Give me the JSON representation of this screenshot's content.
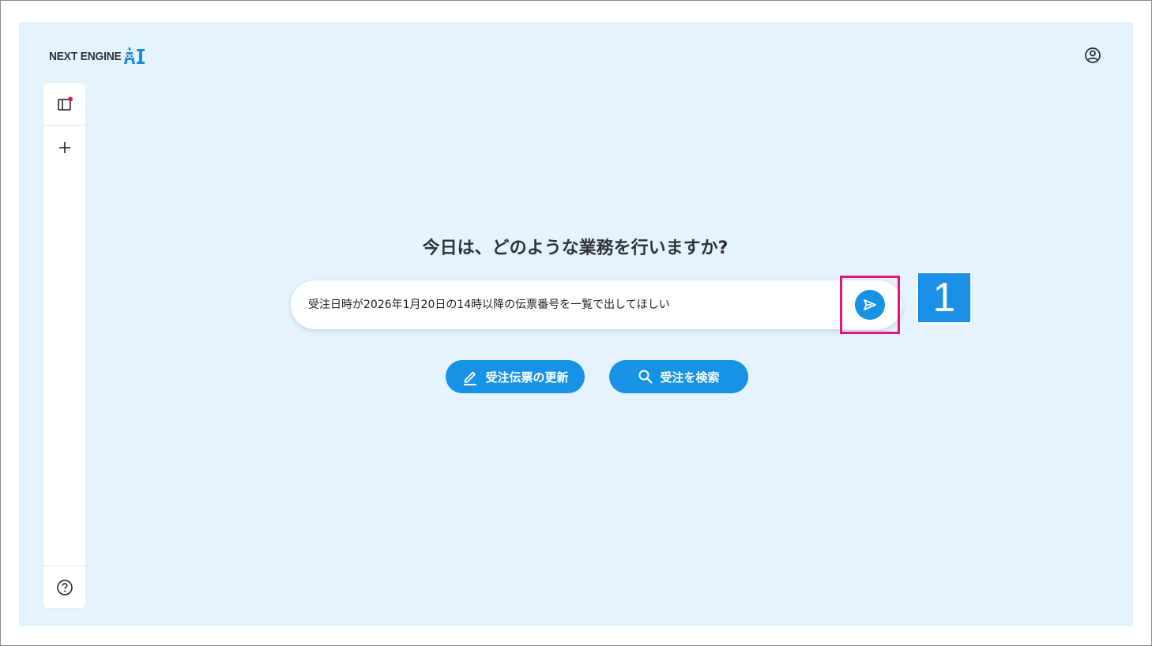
{
  "app": {
    "logo_text": "NEXT ENGINE",
    "logo_ai": "AI",
    "brand_color": "#1792e5"
  },
  "header": {
    "user_icon": "user-circle-icon"
  },
  "sidebar": {
    "items": [
      {
        "icon": "sidebar-panel-icon",
        "has_notification_dot": true
      },
      {
        "icon": "plus-icon"
      },
      {
        "icon": "help-circle-icon"
      }
    ]
  },
  "main": {
    "heading": "今日は、どのような業務を行いますか?",
    "chat": {
      "value": "受注日時が2026年1月20日の14時以降の伝票番号を一覧で出してほしい",
      "send_icon": "send-icon"
    },
    "actions": [
      {
        "label": "受注伝票の更新",
        "icon": "pencil-icon"
      },
      {
        "label": "受注を検索",
        "icon": "search-icon"
      }
    ]
  },
  "annotation": {
    "step_number": "1",
    "highlight_color": "#e5137a"
  }
}
